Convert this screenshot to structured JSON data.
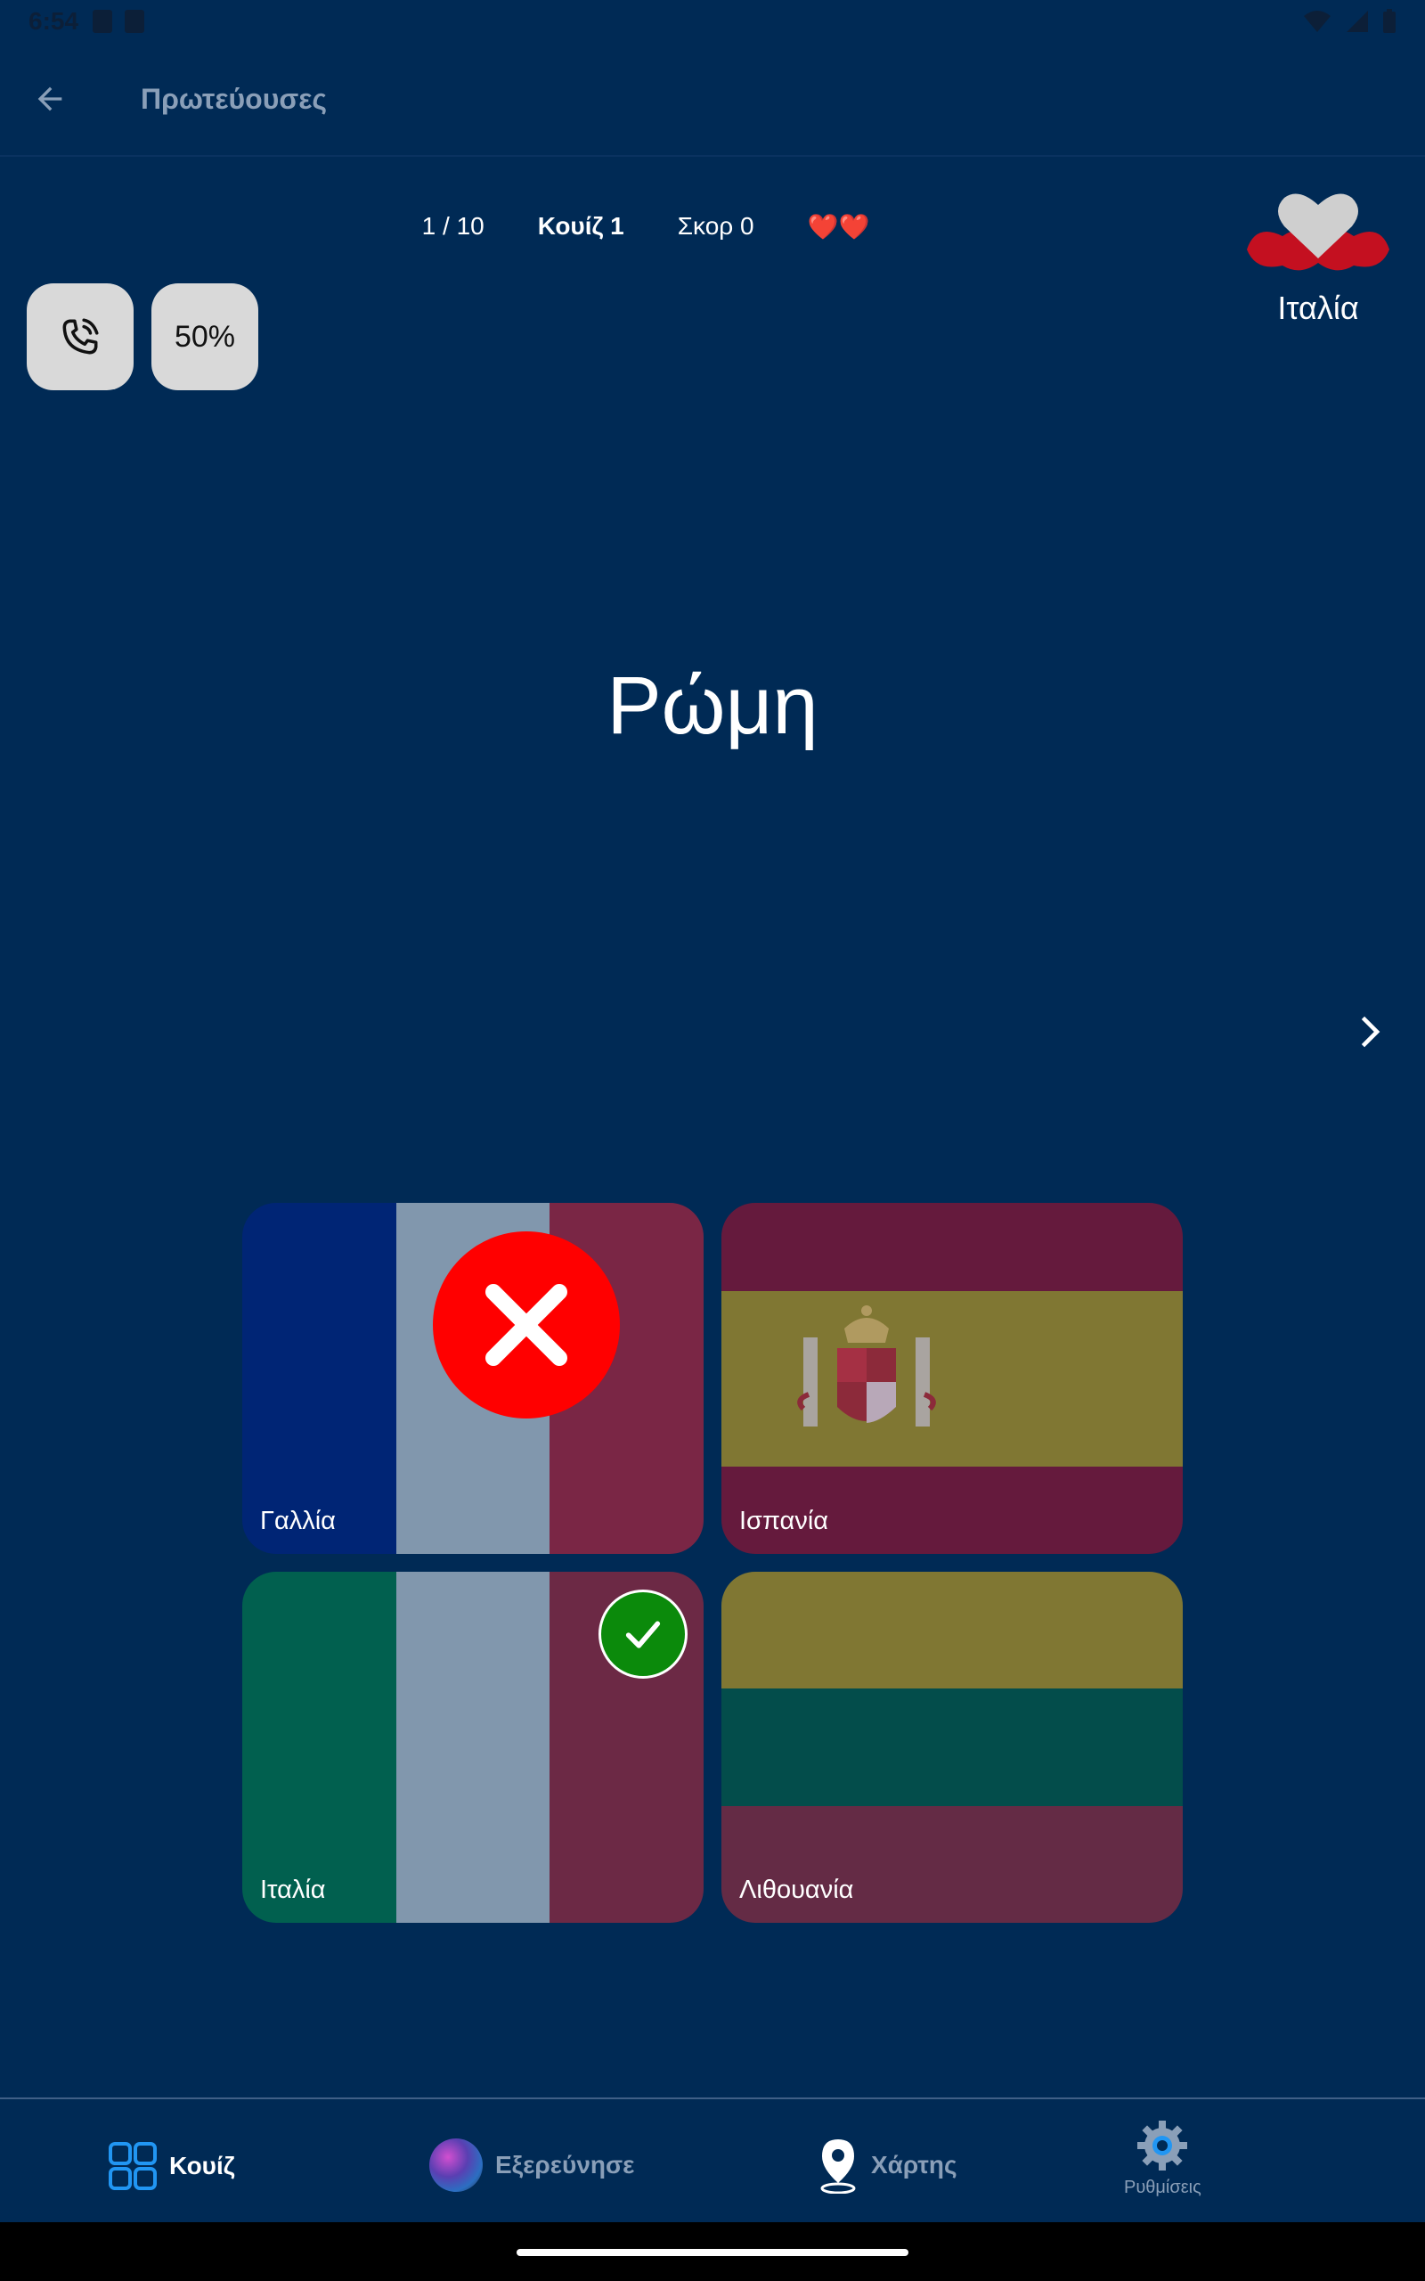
{
  "status_bar": {
    "time": "6:54"
  },
  "app_bar": {
    "title": "Πρωτεύουσες"
  },
  "quiz": {
    "progress": "1 / 10",
    "quiz_label": "Κουίζ 1",
    "score": "Σκορ 0",
    "lives": "❤️❤️"
  },
  "favorite": {
    "country": "Ιταλία"
  },
  "lifelines": {
    "half_label": "50%"
  },
  "question": {
    "capital": "Ρώμη"
  },
  "answers": [
    {
      "label": "Γαλλία",
      "state": "wrong",
      "colors": [
        "#002575",
        "#8197ad",
        "#7a2645"
      ]
    },
    {
      "label": "Ισπανία",
      "state": "neutral",
      "colors": [
        "#651a3d",
        "#807733",
        "#651a3d"
      ]
    },
    {
      "label": "Ιταλία",
      "state": "correct",
      "colors": [
        "#01604f",
        "#8197ad",
        "#6c2945"
      ]
    },
    {
      "label": "Λιθουανία",
      "state": "neutral",
      "colors": [
        "#807733",
        "#034d4b",
        "#642b45"
      ]
    }
  ],
  "nav": {
    "quiz": "Κουίζ",
    "explore": "Εξερεύνησε",
    "map": "Χάρτης",
    "settings": "Ρυθμίσεις"
  },
  "colors": {
    "background": "#002a55",
    "accent": "#2196f3",
    "wrong": "#ff0000",
    "correct": "#0b8a0b"
  }
}
